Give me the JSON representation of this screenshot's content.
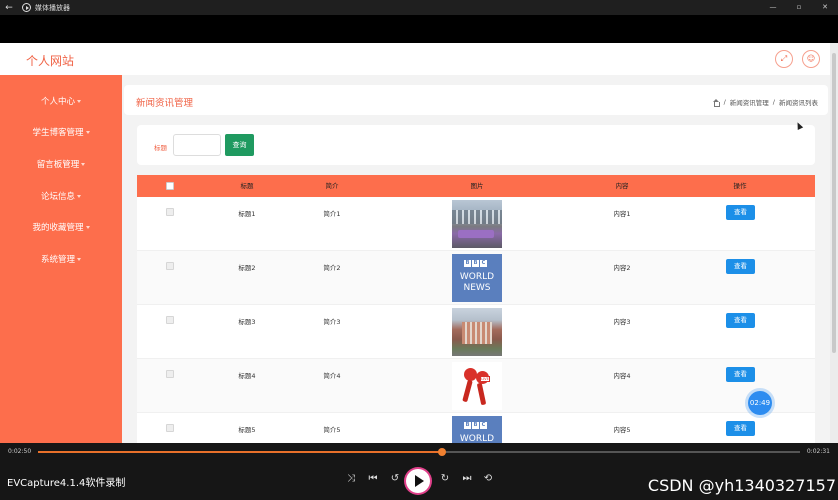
{
  "window": {
    "title": "媒体播放器",
    "controls": [
      "—",
      "▫",
      "✕"
    ]
  },
  "site": {
    "title": "个人网站",
    "header_icons": [
      "fullscreen-icon",
      "user-icon"
    ]
  },
  "sidebar": {
    "items": [
      {
        "label": "个人中心"
      },
      {
        "label": "学生博客管理"
      },
      {
        "label": "留言板管理"
      },
      {
        "label": "论坛信息"
      },
      {
        "label": "我的收藏管理"
      },
      {
        "label": "系统管理"
      }
    ]
  },
  "breadcrumb": {
    "title": "新闻资讯管理",
    "items": [
      "新闻资讯管理",
      "新闻资讯列表"
    ],
    "separator": "/"
  },
  "search": {
    "label": "标题",
    "value": "",
    "button": "查询"
  },
  "table": {
    "columns": [
      "标题",
      "简介",
      "图片",
      "内容",
      "操作"
    ],
    "rows": [
      {
        "title": "标题1",
        "intro": "简介1",
        "image": "building-photo",
        "content": "内容1",
        "action": "查看"
      },
      {
        "title": "标题2",
        "intro": "简介2",
        "image": "bbc-world-news",
        "content": "内容2",
        "action": "查看"
      },
      {
        "title": "标题3",
        "intro": "简介3",
        "image": "school-photo",
        "content": "内容3",
        "action": "查看"
      },
      {
        "title": "标题4",
        "intro": "简介4",
        "image": "live-microphones",
        "content": "内容4",
        "action": "查看"
      },
      {
        "title": "标题5",
        "intro": "简介5",
        "image": "bbc-world-news",
        "content": "内容5",
        "action": "查看"
      }
    ]
  },
  "bbc": {
    "logo": [
      "B",
      "B",
      "C"
    ],
    "line1": "WORLD",
    "line2": "NEWS",
    "live": "LIVE"
  },
  "timer_badge": "02:49",
  "player": {
    "elapsed": "0:02:50",
    "remaining": "0:02:31",
    "progress": 0.53,
    "recorder_label": "EVCapture4.1.4软件录制",
    "watermark": "CSDN @yh1340327157"
  },
  "colors": {
    "accent": "#fd6e4c",
    "title": "#f06245",
    "view_button": "#1c8fe8",
    "search_button": "#1f9a60"
  }
}
